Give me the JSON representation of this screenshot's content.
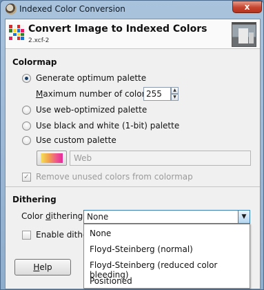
{
  "window": {
    "title": "Indexed Color Conversion",
    "close_label": "x"
  },
  "header": {
    "title": "Convert Image to Indexed Colors",
    "subtitle": "2.xcf-2",
    "icon_colors": [
      "#d32f2f",
      "#f5f5f5",
      "#d32f2f",
      "#f5f5f5",
      "#2e7d32",
      "#fdd835",
      "#1976d2",
      "#e91e63",
      "#f5f5f5",
      "#1976d2",
      "#fdd835",
      "#2e7d32",
      "#e91e63",
      "#f5f5f5",
      "#d32f2f",
      "#1976d2"
    ]
  },
  "colormap": {
    "section_title": "Colormap",
    "options": [
      {
        "label": "Generate optimum palette",
        "checked": true
      },
      {
        "label": "Use web-optimized palette",
        "checked": false
      },
      {
        "label": "Use black and white (1-bit) palette",
        "checked": false
      },
      {
        "label": "Use custom palette",
        "checked": false
      }
    ],
    "max_colors_label_prefix": "M",
    "max_colors_label_rest": "aximum number of colors:",
    "max_colors_value": "255",
    "custom_palette_name": "Web",
    "remove_unused_label": "Remove unused colors from colormap",
    "remove_unused_checked": true
  },
  "dithering": {
    "section_title": "Dithering",
    "color_dithering_label_a": "Color ",
    "color_dithering_label_u": "d",
    "color_dithering_label_b": "ithering:",
    "selected": "None",
    "options": [
      "None",
      "Floyd-Steinberg (normal)",
      "Floyd-Steinberg (reduced color bleeding)",
      "Positioned"
    ],
    "enable_dither_label": "Enable dither"
  },
  "buttons": {
    "help_label_u": "H",
    "help_label_rest": "elp"
  }
}
